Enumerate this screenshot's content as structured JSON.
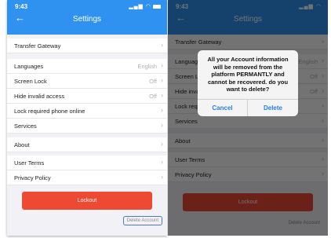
{
  "status": {
    "time": "9:43"
  },
  "nav": {
    "back_icon": "arrow-left-icon",
    "title": "Settings"
  },
  "settings": {
    "transfer_gateway": "Transfer Gateway",
    "languages": {
      "label": "Languages",
      "value": "English"
    },
    "screen_lock": {
      "label": "Screen Lock",
      "value": "Off"
    },
    "hide_invalid_access": {
      "label": "Hide invalid access",
      "value": "Off"
    },
    "lock_required_phone_online": "Lock required phone online",
    "services": "Services",
    "about": "About",
    "user_terms": "User Terms",
    "privacy_policy": "Privacy Policy"
  },
  "actions": {
    "lockout": "Lockout",
    "delete_account": "Delete Account"
  },
  "dialog": {
    "message": "All your Account information will be removed from the platform PERMANTLY and cannot be recovered. do you want to delete?",
    "cancel": "Cancel",
    "delete": "Delete"
  },
  "colors": {
    "header_blue": "#2f92f0",
    "lockout_red": "#ee4a33",
    "link_blue": "#2a7ee6"
  }
}
